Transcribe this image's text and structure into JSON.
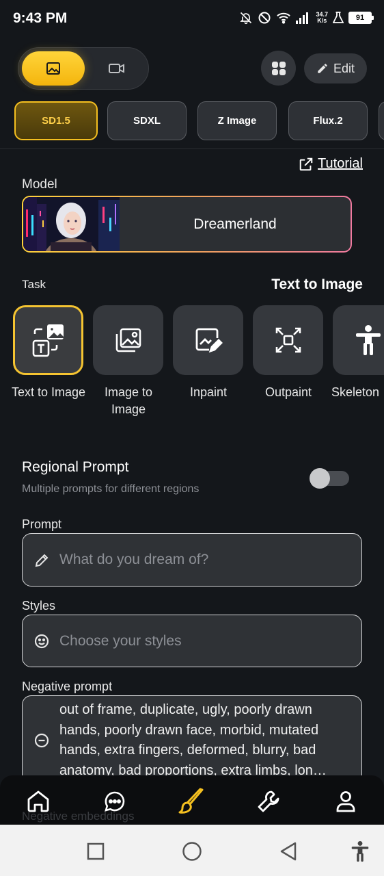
{
  "status_bar": {
    "time": "9:43 PM",
    "net_speed_value": "34.7",
    "net_speed_unit": "K/s",
    "battery": "91"
  },
  "mode_toggle": {
    "image_icon": "image-icon",
    "video_icon": "video-icon"
  },
  "header": {
    "edit_label": "Edit"
  },
  "model_tabs": [
    {
      "label": "SD1.5",
      "active": true
    },
    {
      "label": "SDXL",
      "active": false
    },
    {
      "label": "Z Image",
      "active": false
    },
    {
      "label": "Flux.2",
      "active": false
    }
  ],
  "tutorial": {
    "label": "Tutorial"
  },
  "model": {
    "section_label": "Model",
    "name": "Dreamerland"
  },
  "task": {
    "section_label": "Task",
    "current": "Text to Image",
    "items": [
      {
        "label": "Text to Image",
        "icon": "text-to-image-icon",
        "active": true
      },
      {
        "label": "Image to Image",
        "icon": "image-to-image-icon",
        "active": false
      },
      {
        "label": "Inpaint",
        "icon": "inpaint-icon",
        "active": false
      },
      {
        "label": "Outpaint",
        "icon": "outpaint-icon",
        "active": false
      },
      {
        "label": "Skeleton",
        "icon": "skeleton-icon",
        "active": false
      }
    ]
  },
  "regional_prompt": {
    "title": "Regional Prompt",
    "subtitle": "Multiple prompts for different regions",
    "enabled": false
  },
  "prompt": {
    "label": "Prompt",
    "placeholder": "What do you dream of?"
  },
  "styles": {
    "label": "Styles",
    "placeholder": "Choose your styles"
  },
  "negative_prompt": {
    "label": "Negative prompt",
    "value": "out of frame, duplicate, ugly, poorly drawn hands, poorly drawn face, morbid, mutated hands, extra fingers, deformed, blurry, bad anatomy, bad proportions, extra limbs, lon…"
  },
  "hidden_section_label": "Negative embeddings",
  "bottom_nav": [
    {
      "icon": "home-icon"
    },
    {
      "icon": "chat-icon"
    },
    {
      "icon": "brush-icon",
      "active": true
    },
    {
      "icon": "wrench-icon"
    },
    {
      "icon": "profile-icon"
    }
  ],
  "colors": {
    "accent": "#f5c020",
    "background": "#14171b",
    "card": "#2f3236"
  }
}
